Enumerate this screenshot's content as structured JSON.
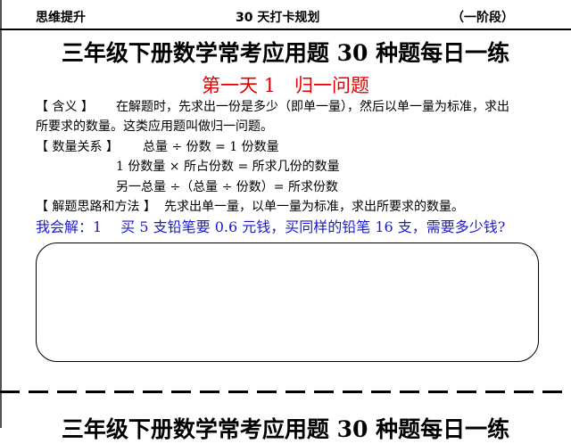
{
  "header": {
    "left": "思维提升",
    "center": "30 天打卡规划",
    "right": "（一阶段）"
  },
  "title": "三年级下册数学常考应用题 30 种题每日一练",
  "day_title": "第一天 1　归一问题",
  "meaning": {
    "label": "【 含义 】",
    "line1": "在解题时，先求出一份是多少（即单一量），然后以单一量为标准，求出",
    "line2": "所要求的数量。这类应用题叫做归一问题。"
  },
  "relations": {
    "label": "【 数量关系 】",
    "line1": "总量 ÷ 份数 = 1 份数量",
    "line2": "1 份数量 × 所占份数 = 所求几份的数量",
    "line3": "另一总量 ÷（总量 ÷ 份数）= 所求份数"
  },
  "method": {
    "label": "【 解题思路和方法 】",
    "text": "先求出单一量，以单一量为标准，求出所要求的数量。"
  },
  "exercise": "我会解：1　 买 5 支铅笔要 0.6 元钱，买同样的铅笔 16 支，需要多少钱?",
  "next_title": "三年级下册数学常考应用题 30 种题每日一练"
}
